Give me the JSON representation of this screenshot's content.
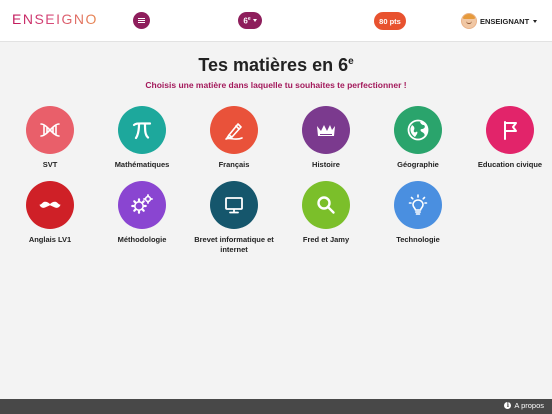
{
  "header": {
    "logo": "ENSEIGNO",
    "level_label": "6",
    "level_suffix": "e",
    "points_label": "80 pts",
    "user_label": "ENSEIGNANT"
  },
  "main": {
    "title": "Tes matières en 6",
    "title_suffix": "e",
    "subtitle": "Choisis une matière dans laquelle tu souhaites te perfectionner !"
  },
  "subjects": [
    {
      "label": "SVT",
      "color": "#e95f6a",
      "icon": "dna-icon"
    },
    {
      "label": "Mathématiques",
      "color": "#1da89c",
      "icon": "pi-icon"
    },
    {
      "label": "Français",
      "color": "#e9523a",
      "icon": "pen-icon"
    },
    {
      "label": "Histoire",
      "color": "#7b3a8e",
      "icon": "crown-icon"
    },
    {
      "label": "Géographie",
      "color": "#2aa46c",
      "icon": "globe-icon"
    },
    {
      "label": "Education civique",
      "color": "#e2246a",
      "icon": "flag-icon"
    },
    {
      "label": "Anglais LV1",
      "color": "#cf2027",
      "icon": "mustache-icon"
    },
    {
      "label": "Méthodologie",
      "color": "#8a45d1",
      "icon": "gears-icon"
    },
    {
      "label": "Brevet informatique et internet",
      "color": "#15566c",
      "icon": "monitor-icon"
    },
    {
      "label": "Fred et Jamy",
      "color": "#7bbf2a",
      "icon": "magnifier-icon"
    },
    {
      "label": "Technologie",
      "color": "#4a8fe0",
      "icon": "lightbulb-icon"
    }
  ],
  "footer": {
    "about_label": "A propos"
  }
}
